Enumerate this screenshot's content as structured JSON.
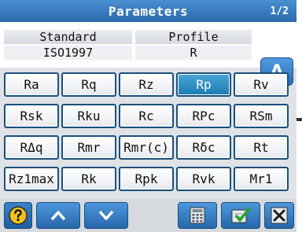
{
  "header": {
    "title": "Parameters",
    "page_indicator": "1/2"
  },
  "info": {
    "standard_label": "Standard",
    "standard_value": "ISO1997",
    "profile_label": "Profile",
    "profile_value": "R",
    "a_button_label": "A"
  },
  "params": [
    "Ra",
    "Rq",
    "Rz",
    "Rp",
    "Rv",
    "Rsk",
    "Rku",
    "Rc",
    "RPc",
    "RSm",
    "RΔq",
    "Rmr",
    "Rmr(c)",
    "Rδc",
    "Rt",
    "Rz1max",
    "Rk",
    "Rpk",
    "Rvk",
    "Mr1"
  ],
  "selected_param": "Rp",
  "icons": {
    "help": "question-mark-icon",
    "up": "chevron-up-icon",
    "down": "chevron-down-icon",
    "calc": "calculator-icon",
    "confirm": "checkmark-icon",
    "close": "close-icon"
  },
  "colors": {
    "title_bg": "#2c6aac",
    "button_border": "#1b4f7a",
    "selected": "#1b7cb2"
  }
}
